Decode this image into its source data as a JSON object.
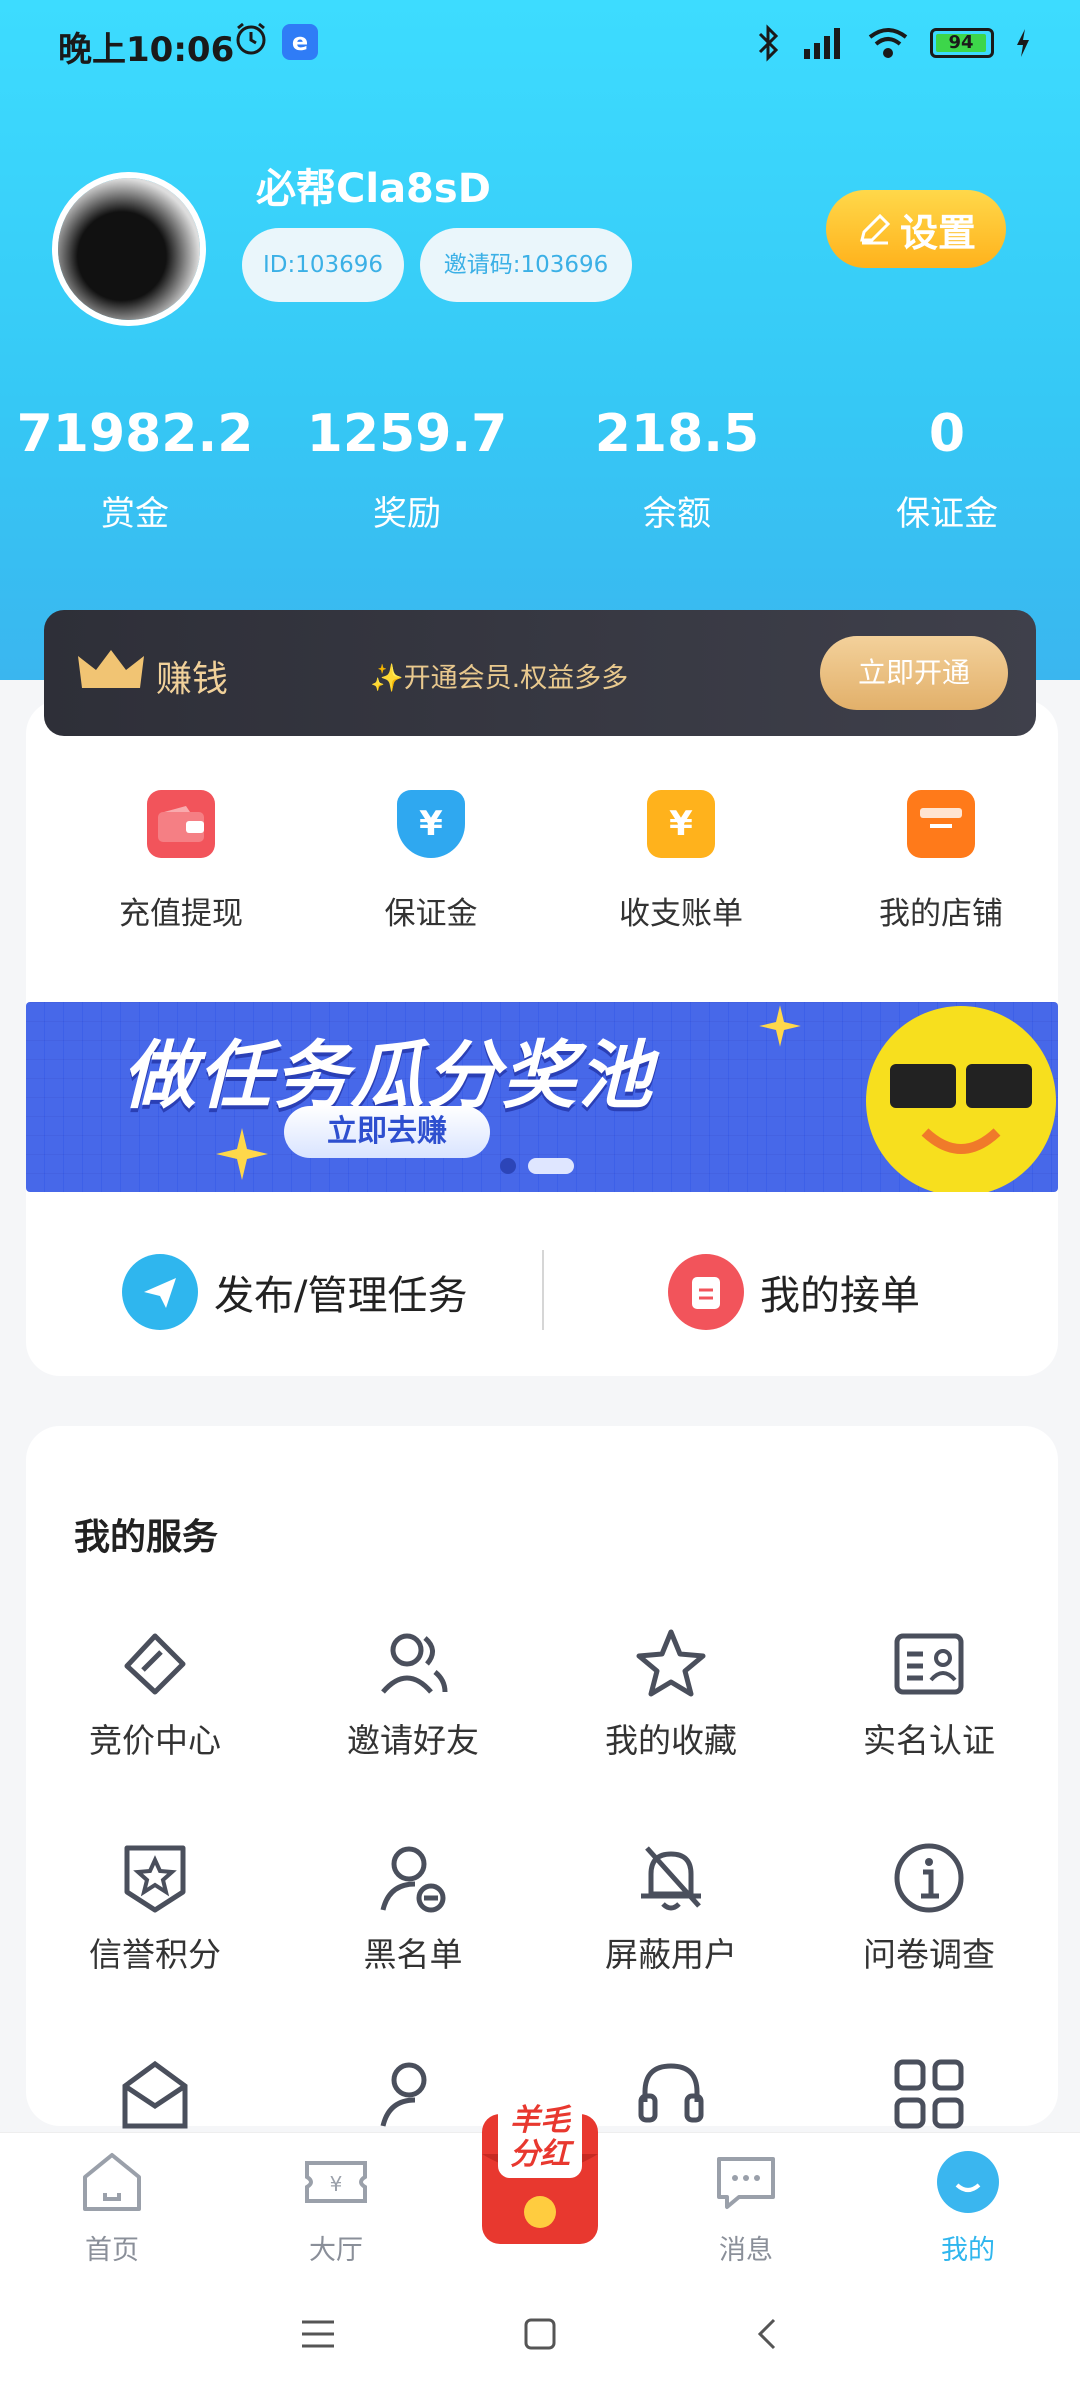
{
  "status_bar": {
    "time": "晚上10:06",
    "battery": "94"
  },
  "profile": {
    "username": "必帮Cla8sD",
    "id_label": "ID:103696",
    "invite_label": "邀请码:103696",
    "settings_label": "设置"
  },
  "stats": [
    {
      "value": "71982.2",
      "label": "赏金"
    },
    {
      "value": "1259.7",
      "label": "奖励"
    },
    {
      "value": "218.5",
      "label": "余额"
    },
    {
      "value": "0",
      "label": "保证金"
    }
  ],
  "vip": {
    "title": "赚钱",
    "description": "✨开通会员.权益多多",
    "button": "立即开通"
  },
  "quick_actions": [
    {
      "label": "充值提现",
      "icon": "wallet-icon",
      "color": "#f2545b"
    },
    {
      "label": "保证金",
      "icon": "shield-yen-icon",
      "color": "#2fa8f0"
    },
    {
      "label": "收支账单",
      "icon": "bill-icon",
      "color": "#ffb21c"
    },
    {
      "label": "我的店铺",
      "icon": "shop-icon",
      "color": "#ff7a1a"
    }
  ],
  "promo": {
    "title": "做任务瓜分奖池",
    "button": "立即去赚"
  },
  "task_actions": {
    "publish": "发布/管理任务",
    "my_orders": "我的接单"
  },
  "services": {
    "title": "我的服务",
    "items": [
      {
        "label": "竞价中心",
        "icon": "bid-tag-icon"
      },
      {
        "label": "邀请好友",
        "icon": "invite-friends-icon"
      },
      {
        "label": "我的收藏",
        "icon": "star-icon"
      },
      {
        "label": "实名认证",
        "icon": "id-card-icon"
      },
      {
        "label": "信誉积分",
        "icon": "badge-star-icon"
      },
      {
        "label": "黑名单",
        "icon": "user-block-icon"
      },
      {
        "label": "屏蔽用户",
        "icon": "bell-off-icon"
      },
      {
        "label": "问卷调查",
        "icon": "info-icon"
      }
    ]
  },
  "bottom_nav": {
    "items": [
      {
        "label": "首页",
        "icon": "home-icon"
      },
      {
        "label": "大厅",
        "icon": "ticket-yen-icon"
      },
      {
        "label": "消息",
        "icon": "message-icon"
      },
      {
        "label": "我的",
        "icon": "profile-face-icon"
      }
    ],
    "center_badge": "羊毛分红"
  },
  "colors": {
    "accent": "#2fb6ee",
    "header_gradient_top": "#3ddcff",
    "settings_gold": "#ffb21c",
    "vip_dark": "#2e2f38"
  }
}
